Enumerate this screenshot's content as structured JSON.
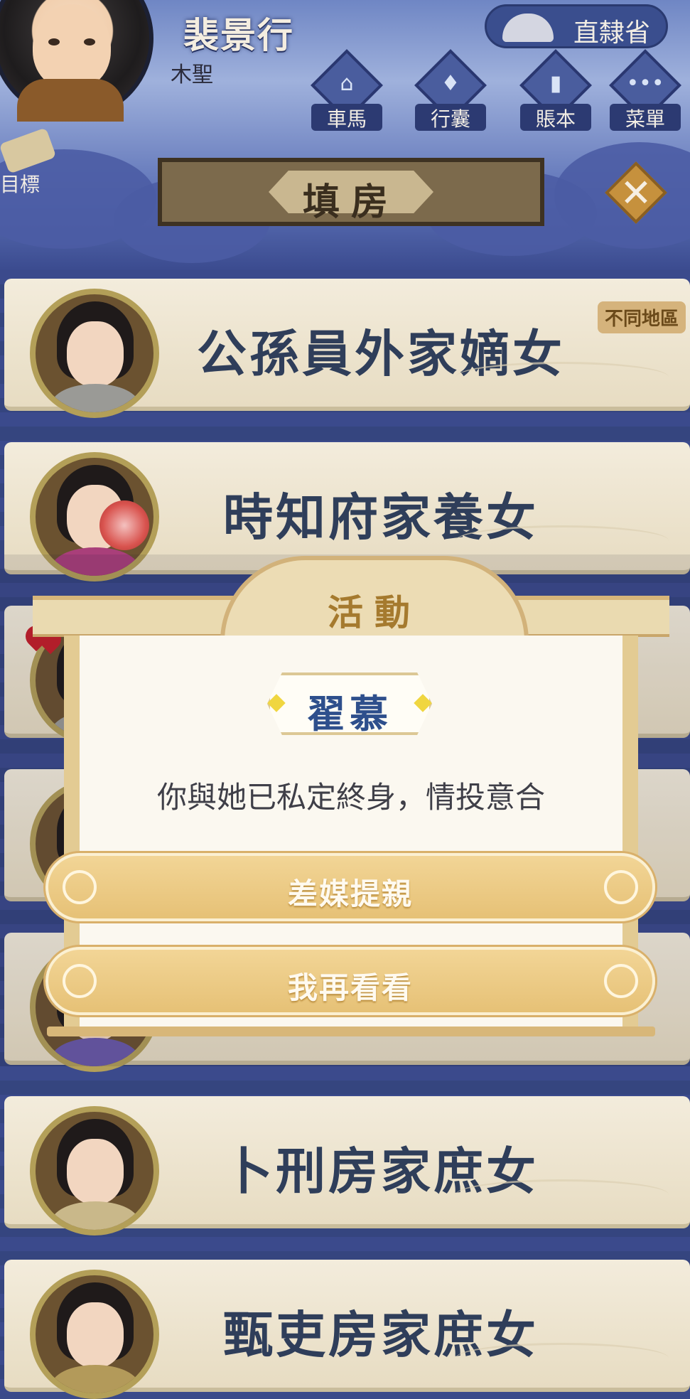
{
  "header": {
    "player_name": "裴景行",
    "player_title": "木聖",
    "region": "直隸省",
    "nav": [
      {
        "label": "車馬",
        "icon": "carriage-icon"
      },
      {
        "label": "行囊",
        "icon": "bag-icon"
      },
      {
        "label": "賬本",
        "icon": "ledger-icon"
      },
      {
        "label": "菜單",
        "icon": "menu-dots-icon"
      }
    ],
    "goal_label": "目標"
  },
  "page": {
    "title": "填房",
    "close_glyph": "✕"
  },
  "list": {
    "rows": [
      {
        "name": "公孫員外家嫡女",
        "tag": "不同地區"
      },
      {
        "name": "時知府家養女",
        "tag": ""
      },
      {
        "name": "",
        "tag": ""
      },
      {
        "name": "",
        "tag": ""
      },
      {
        "name": "",
        "tag": ""
      },
      {
        "name": "卜刑房家庶女",
        "tag": ""
      },
      {
        "name": "甄吏房家庶女",
        "tag": ""
      }
    ]
  },
  "popup": {
    "title": "活動",
    "event_name": "翟慕",
    "message": "你與她已私定終身，情投意合",
    "buttons": {
      "propose": "差媒提親",
      "later": "我再看看"
    }
  },
  "colors": {
    "accent_gold": "#e6c176",
    "name_text": "#2f3e5a",
    "event_blue": "#2e4f8c"
  }
}
